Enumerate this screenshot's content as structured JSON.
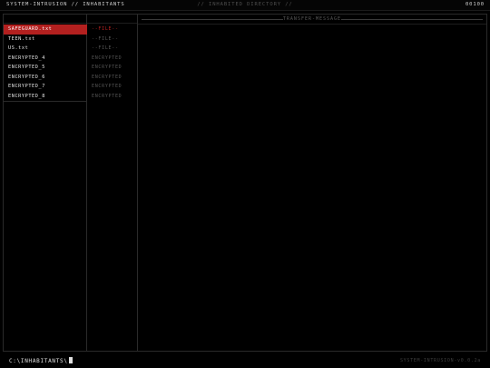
{
  "topbar": {
    "left": "SYSTEM-INTRUSION // INHABITANTS",
    "center": "// INHABITED DIRECTORY //",
    "right": "00100"
  },
  "files": [
    {
      "name": "SAFEGUARD.txt",
      "active": true
    },
    {
      "name": "TEEN.txt",
      "active": false
    },
    {
      "name": "US.txt",
      "active": false
    },
    {
      "name": "ENCRYPTED_4",
      "active": false
    },
    {
      "name": "ENCRYPTED_5",
      "active": false
    },
    {
      "name": "ENCRYPTED_6",
      "active": false
    },
    {
      "name": "ENCRYPTED_7",
      "active": false
    },
    {
      "name": "ENCRYPTED_8",
      "active": false
    }
  ],
  "status": [
    {
      "text": "--FILE--",
      "hot": true
    },
    {
      "text": "--FILE--",
      "hot": false
    },
    {
      "text": "--FILE--",
      "hot": false
    },
    {
      "text": "ENCRYPTED",
      "hot": false
    },
    {
      "text": "ENCRYPTED",
      "hot": false
    },
    {
      "text": "ENCRYPTED",
      "hot": false
    },
    {
      "text": "ENCRYPTED",
      "hot": false
    },
    {
      "text": "ENCRYPTED",
      "hot": false
    }
  ],
  "message": {
    "title": "TRANSFER-MESSAGE",
    "body": ""
  },
  "bottombar": {
    "prompt": "C:\\INHABITANTS\\",
    "version": "SYSTEM-INTRUSION-v0.0.2a"
  },
  "colors": {
    "accent": "#b3201f",
    "background": "#000000",
    "text": "#e6e6e6",
    "muted": "#555555"
  }
}
